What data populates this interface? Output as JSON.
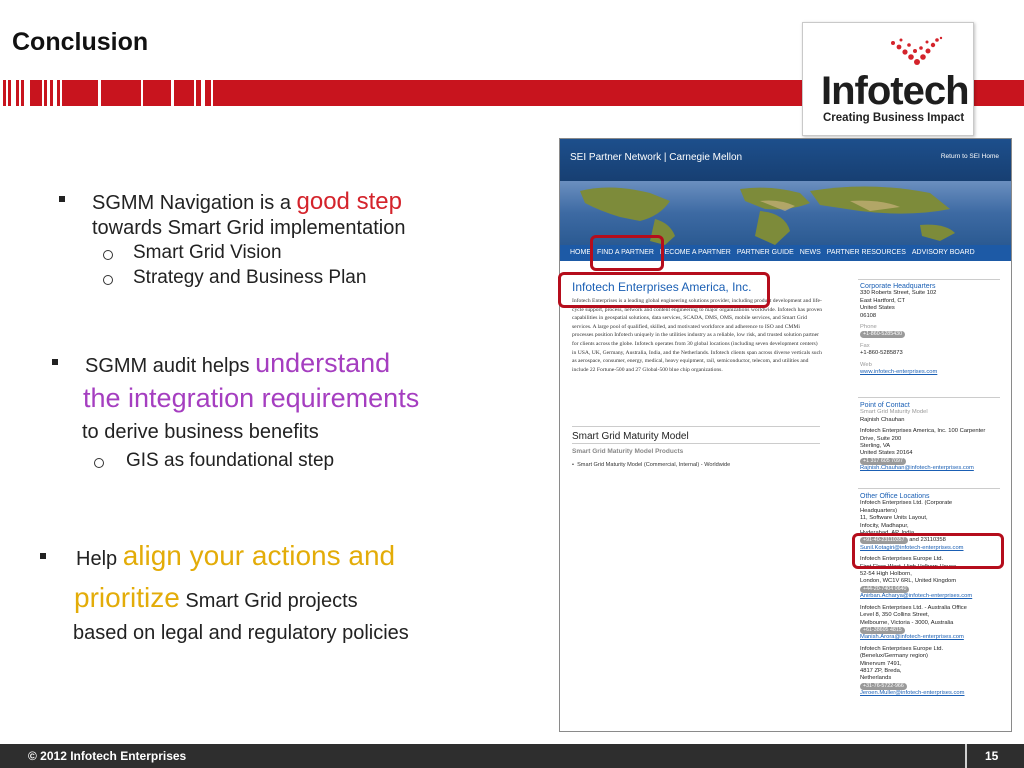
{
  "page": {
    "title": "Conclusion"
  },
  "logo": {
    "name": "Infotech",
    "tagline": "Creating Business Impact"
  },
  "bullets": {
    "b1": {
      "prefix": "SGMM Navigation is a ",
      "highlight": "good step",
      "line2": "towards Smart Grid implementation",
      "sub": [
        "Smart Grid Vision",
        "Strategy and Business Plan"
      ]
    },
    "b2": {
      "prefix": "SGMM audit helps ",
      "highlight1": "understand",
      "highlight2": "the integration requirements",
      "line3": "to derive business benefits",
      "sub": [
        "GIS as foundational step"
      ]
    },
    "b3": {
      "prefix": "Help ",
      "highlight1": "align your actions and",
      "highlight2": "prioritize",
      "rest2": " Smart Grid projects",
      "line3": "based on legal and regulatory policies"
    }
  },
  "web": {
    "brand": "SEI Partner Network | Carnegie Mellon",
    "return_link": "Return to SEI Home",
    "nav": [
      "HOME",
      "FIND A PARTNER",
      "BECOME A PARTNER",
      "PARTNER GUIDE",
      "NEWS",
      "PARTNER RESOURCES",
      "ADVISORY BOARD"
    ],
    "company": "Infotech Enterprises America, Inc.",
    "body": "Infotech Enterprises is a leading global engineering solutions provider, including product development and life-cycle support, process, network and content engineering to major organizations worldwide. Infotech has proven capabilities in geospatial solutions, data services, SCADA, DMS, OMS, mobile services, and Smart Grid services. A large pool of qualified, skilled, and motivated workforce and adherence to ISO and CMMi processes position Infotech uniquely in the utilities industry as a reliable, low risk, and trusted solution partner for clients across the globe. Infotech operates from 30 global locations (including seven development centers) in USA, UK, Germany, Australia, India, and the Netherlands. Infotech clients span across diverse verticals such as aerospace, consumer, energy, medical, heavy equipment, rail, semiconductor, telecom, and utilities and include 22 Fortune-500 and 27 Global-500 blue chip organizations.",
    "sgmm_heading": "Smart Grid Maturity Model",
    "sgmm_sub": "Smart Grid Maturity Model Products",
    "sgmm_item": "Smart Grid Maturity Model (Commercial, Internal) - Worldwide",
    "hq": {
      "heading": "Corporate Headquarters",
      "address": [
        "330 Roberts Street, Suite 102",
        "East Hartford, CT",
        "United States",
        "06108"
      ],
      "phone_label": "Phone",
      "phone": "+1-860-5285430",
      "fax_label": "Fax",
      "fax": "+1-860-5285873",
      "web_label": "Web",
      "web": "www.infotech-enterprises.com"
    },
    "poc": {
      "heading": "Point of Contact",
      "role": "Smart Grid Maturity Model",
      "name": "Rajnish Chauhan",
      "address": [
        "Infotech Enterprises America, Inc. 100 Carpenter",
        "Drive, Suite 200",
        "Sterling, VA",
        "United States 20164"
      ],
      "phone": "+1 317 605 7097",
      "email": "Rajnish.Chauhan@infotech-enterprises.com"
    },
    "offices": {
      "heading": "Other Office Locations",
      "o1": {
        "lines": [
          "Infotech Enterprises Ltd. (Corporate",
          "Headquarters)",
          "11, Software Units Layout,",
          "Infocity, Madhapur,",
          "Hyderabad, AP, India"
        ],
        "phone": "+91-40-23110357",
        "extra": " and 23110358",
        "email": "Sunil.Kotagiri@infotech-enterprises.com"
      },
      "o2": {
        "lines": [
          "Infotech Enterprises Europe Ltd.",
          "First Floor West, High Holborn House,",
          "52-54 High Holborn,",
          "London, WC1V 6RL, United Kingdom"
        ],
        "phone": "+44-20-7404 0640",
        "email": "Anirban.Acharya@infotech-enterprises.com"
      },
      "o3": {
        "lines": [
          "Infotech Enterprises Ltd. - Australia Office",
          "Level 8, 350 Collins Street,",
          "Melbourne, Victoria - 3000, Australia"
        ],
        "phone": "+61-38605 4815",
        "email": "Manish.Arora@infotech-enterprises.com"
      },
      "o4": {
        "lines": [
          "Infotech Enterprises Europe Ltd.",
          "(Benelux/Germany region)",
          "Minervum 7491,",
          "4817 ZP, Breda,",
          "Netherlands"
        ],
        "phone": "+31-76-5722-966",
        "email": "Jeroen.Muller@infotech-enterprises.com"
      }
    }
  },
  "footer": {
    "copyright": "© 2012 Infotech Enterprises",
    "page_number": "15"
  }
}
